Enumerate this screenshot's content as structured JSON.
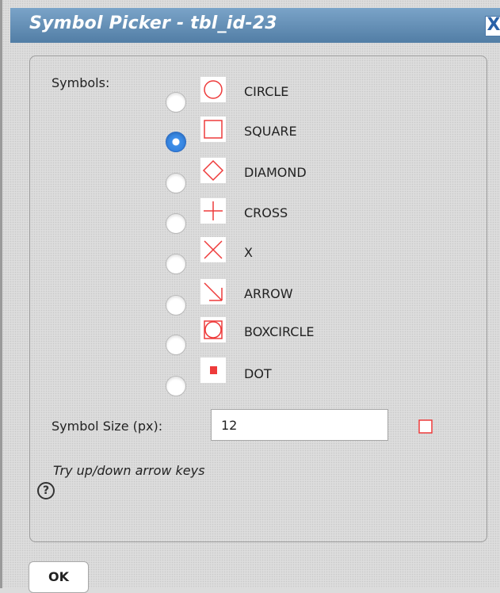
{
  "dialog": {
    "title": "Symbol Picker - tbl_id-23",
    "close_glyph": "X"
  },
  "symbols_label": "Symbols:",
  "symbols": [
    {
      "name": "CIRCLE",
      "selected": false
    },
    {
      "name": "SQUARE",
      "selected": true
    },
    {
      "name": "DIAMOND",
      "selected": false
    },
    {
      "name": "CROSS",
      "selected": false
    },
    {
      "name": "X",
      "selected": false
    },
    {
      "name": "ARROW",
      "selected": false
    },
    {
      "name": "BOXCIRCLE",
      "selected": false
    },
    {
      "name": "DOT",
      "selected": false
    }
  ],
  "symbol_size": {
    "label": "Symbol Size (px):",
    "value": "12"
  },
  "hint": "Try up/down arrow keys",
  "help_glyph": "?",
  "ok_label": "OK",
  "colors": {
    "accent": "#5d8fbc",
    "symbol": "#ee3b3b",
    "radio_selected": "#2f7ad8"
  },
  "icons": {
    "close": "close-icon",
    "help": "help-icon"
  }
}
